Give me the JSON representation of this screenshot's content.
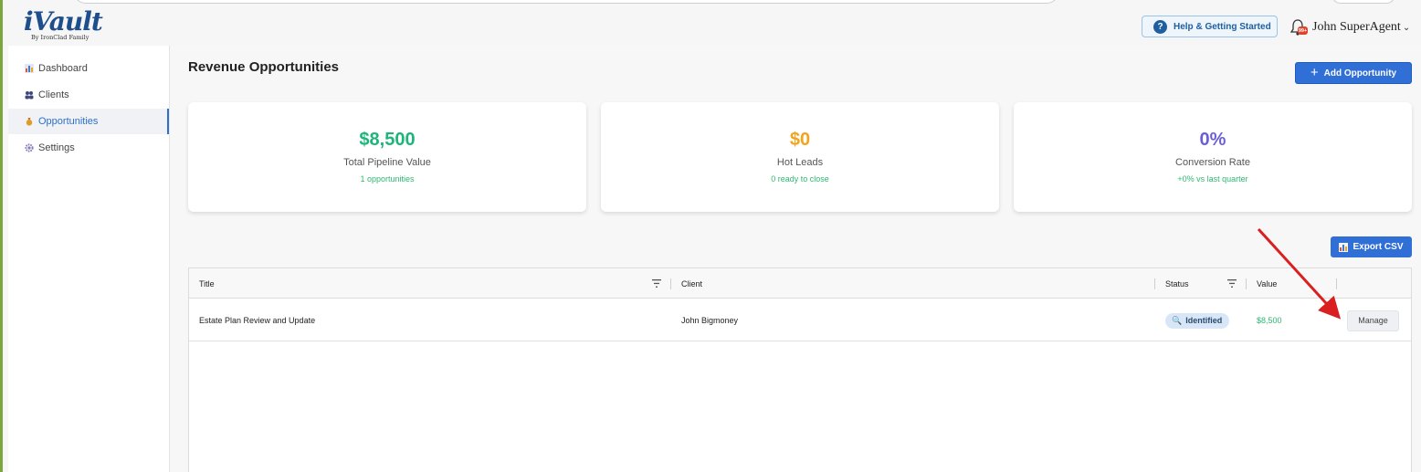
{
  "app": {
    "logo_text": "iVault",
    "logo_tagline": "By IronClad Family"
  },
  "header": {
    "help_label": "Help & Getting Started",
    "notification_badge": "99+",
    "user_name": "John SuperAgent"
  },
  "sidebar": {
    "items": [
      {
        "label": "Dashboard",
        "icon": "bar-chart-icon",
        "active": false
      },
      {
        "label": "Clients",
        "icon": "users-icon",
        "active": false
      },
      {
        "label": "Opportunities",
        "icon": "money-bag-icon",
        "active": true
      },
      {
        "label": "Settings",
        "icon": "gear-icon",
        "active": false
      }
    ]
  },
  "page": {
    "title": "Revenue Opportunities",
    "add_button_label": "Add Opportunity",
    "export_button_label": "Export CSV"
  },
  "stats": [
    {
      "value": "$8,500",
      "label": "Total Pipeline Value",
      "sub": "1 opportunities",
      "color": "#1db57a"
    },
    {
      "value": "$0",
      "label": "Hot Leads",
      "sub": "0 ready to close",
      "color": "#f2a51a"
    },
    {
      "value": "0%",
      "label": "Conversion Rate",
      "sub": "+0% vs last quarter",
      "color": "#6b5fd8"
    }
  ],
  "table": {
    "columns": [
      "Title",
      "Client",
      "Status",
      "Value",
      ""
    ],
    "rows": [
      {
        "title": "Estate Plan Review and Update",
        "client": "John Bigmoney",
        "status": "Identified",
        "value": "$8,500",
        "action": "Manage"
      }
    ]
  },
  "colors": {
    "primary": "#2f6fd6",
    "success": "#2eb872",
    "annotation_arrow": "#d91f1f"
  }
}
